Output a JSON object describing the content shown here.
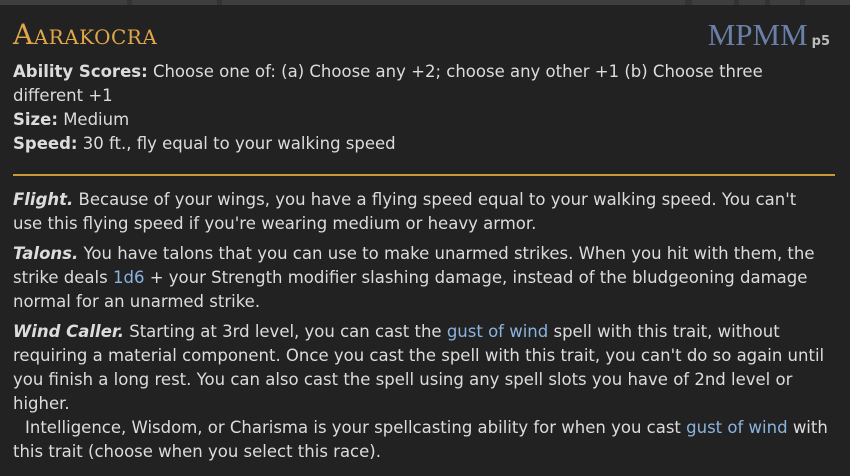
{
  "race": {
    "name": "Aarakocra",
    "source": "MPMM",
    "page": "p5"
  },
  "stats": {
    "ability_label": "Ability Scores:",
    "ability_value": "Choose one of: (a) Choose any +2; choose any other +1 (b) Choose three different +1",
    "size_label": "Size:",
    "size_value": "Medium",
    "speed_label": "Speed:",
    "speed_value": "30 ft., fly equal to your walking speed"
  },
  "traits": {
    "flight": {
      "name": "Flight.",
      "text": "Because of your wings, you have a flying speed equal to your walking speed. You can't use this flying speed if you're wearing medium or heavy armor."
    },
    "talons": {
      "name": "Talons.",
      "text_a": "You have talons that you can use to make unarmed strikes. When you hit with them, the strike deals",
      "dice": "1d6",
      "text_b": "+ your Strength modifier slashing damage, instead of the bludgeoning damage normal for an unarmed strike."
    },
    "wind_caller": {
      "name": "Wind Caller.",
      "text_a": "Starting at 3rd level, you can cast the",
      "spell": "gust of wind",
      "text_b": "spell with this trait, without requiring a material component. Once you cast the spell with this trait, you can't do so again until you finish a long rest. You can also cast the spell using any spell slots you have of 2nd level or higher.",
      "text_c": "Intelligence, Wisdom, or Charisma is your spellcasting ability for when you cast",
      "spell2": "gust of wind",
      "text_d": "with this trait (choose when you select this race)."
    }
  },
  "colors": {
    "background": "#222222",
    "text": "#dcdcdc",
    "title": "#e0a64a",
    "source": "#6a80a8",
    "link": "#8ab4e0",
    "divider": "#c69a3a"
  }
}
